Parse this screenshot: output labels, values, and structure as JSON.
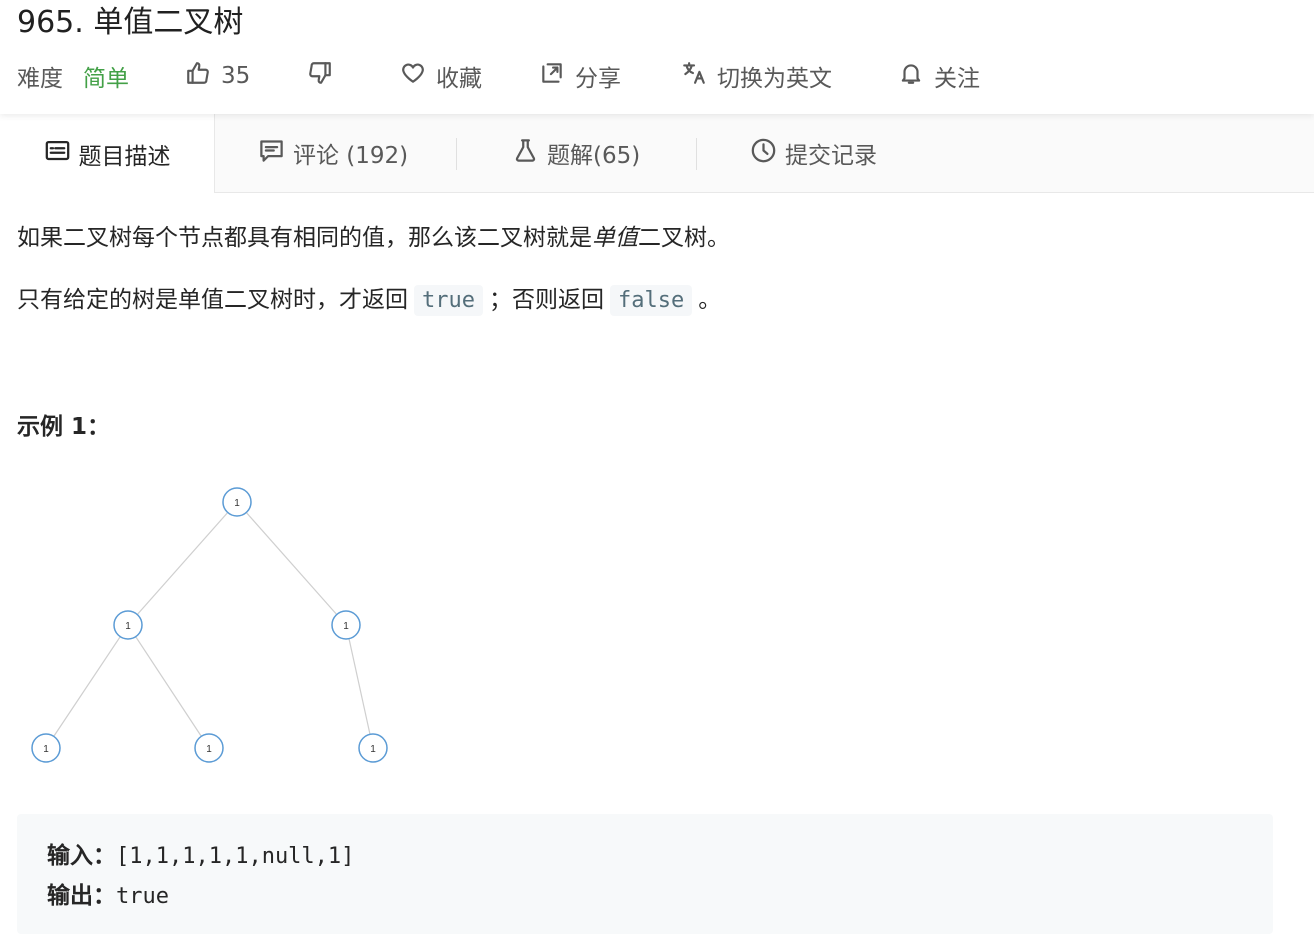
{
  "problem": {
    "title": "965. 单值二叉树",
    "difficulty_label": "难度",
    "difficulty_value": "简单",
    "likes": "35",
    "favorite_label": "收藏",
    "share_label": "分享",
    "switch_lang_label": "切换为英文",
    "follow_label": "关注"
  },
  "tabs": [
    {
      "label": "题目描述",
      "icon": "description-icon"
    },
    {
      "label": "评论 (192)",
      "icon": "comment-icon"
    },
    {
      "label": "题解(65)",
      "icon": "flask-icon"
    },
    {
      "label": "提交记录",
      "icon": "clock-icon"
    }
  ],
  "description": {
    "p1_a": "如果二叉树每个节点都具有相同的值，那么该二叉树就是",
    "p1_em": "单值",
    "p1_b": "二叉树。",
    "p2_a": "只有给定的树是单值二叉树时，才返回",
    "p2_true": "true",
    "p2_b": "；否则返回",
    "p2_false": "false",
    "p2_c": "。"
  },
  "example": {
    "title": "示例 1：",
    "tree_nodes": [
      "1",
      "1",
      "1",
      "1",
      "1",
      "1"
    ],
    "input_label": "输入：",
    "input_value": "[1,1,1,1,1,null,1]",
    "output_label": "输出：",
    "output_value": "true"
  },
  "colors": {
    "accent_green": "#43a047",
    "node_stroke": "#5b9bd5",
    "code_bg": "#f7f9fa"
  }
}
